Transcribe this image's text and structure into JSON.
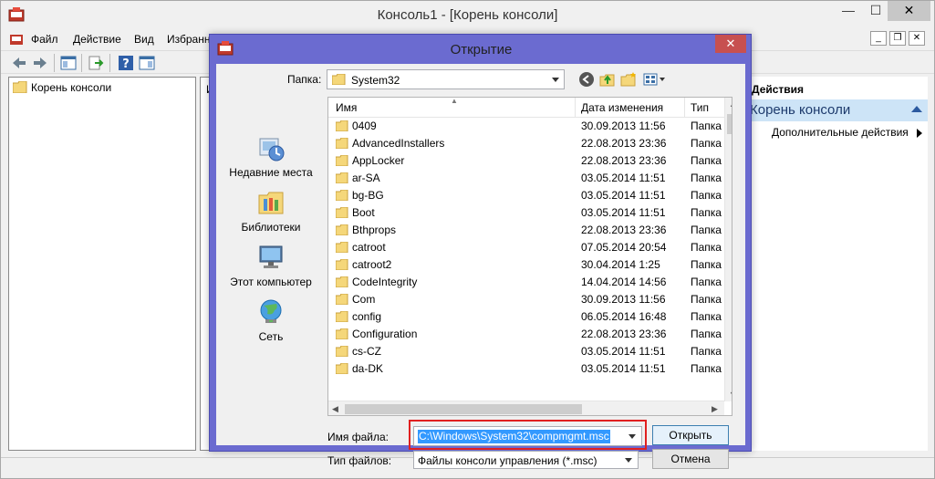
{
  "mmc": {
    "title": "Консоль1 - [Корень консоли]",
    "menu": [
      "Файл",
      "Действие",
      "Вид",
      "Избранное"
    ],
    "tree_root": "Корень консоли",
    "center_header": "И",
    "actions": {
      "title": "Действия",
      "selected": "Корень консоли",
      "more": "Дополнительные действия"
    }
  },
  "dialog": {
    "title": "Открытие",
    "close_glyph": "✕",
    "folder_label": "Папка:",
    "folder_value": "System32",
    "places": [
      {
        "label": "Недавние места",
        "icon": "recent-places-icon"
      },
      {
        "label": "Библиотеки",
        "icon": "libraries-icon"
      },
      {
        "label": "Этот компьютер",
        "icon": "this-pc-icon"
      },
      {
        "label": "Сеть",
        "icon": "network-icon"
      }
    ],
    "columns": {
      "name": "Имя",
      "date": "Дата изменения",
      "type": "Тип"
    },
    "files": [
      {
        "name": "0409",
        "date": "30.09.2013 11:56",
        "type": "Папка"
      },
      {
        "name": "AdvancedInstallers",
        "date": "22.08.2013 23:36",
        "type": "Папка"
      },
      {
        "name": "AppLocker",
        "date": "22.08.2013 23:36",
        "type": "Папка"
      },
      {
        "name": "ar-SA",
        "date": "03.05.2014 11:51",
        "type": "Папка"
      },
      {
        "name": "bg-BG",
        "date": "03.05.2014 11:51",
        "type": "Папка"
      },
      {
        "name": "Boot",
        "date": "03.05.2014 11:51",
        "type": "Папка"
      },
      {
        "name": "Bthprops",
        "date": "22.08.2013 23:36",
        "type": "Папка"
      },
      {
        "name": "catroot",
        "date": "07.05.2014 20:54",
        "type": "Папка"
      },
      {
        "name": "catroot2",
        "date": "30.04.2014 1:25",
        "type": "Папка"
      },
      {
        "name": "CodeIntegrity",
        "date": "14.04.2014 14:56",
        "type": "Папка"
      },
      {
        "name": "Com",
        "date": "30.09.2013 11:56",
        "type": "Папка"
      },
      {
        "name": "config",
        "date": "06.05.2014 16:48",
        "type": "Папка"
      },
      {
        "name": "Configuration",
        "date": "22.08.2013 23:36",
        "type": "Папка"
      },
      {
        "name": "cs-CZ",
        "date": "03.05.2014 11:51",
        "type": "Папка"
      },
      {
        "name": "da-DK",
        "date": "03.05.2014 11:51",
        "type": "Папка"
      }
    ],
    "filename_label": "Имя файла:",
    "filename_value": "C:\\Windows\\System32\\compmgmt.msc",
    "filetype_label": "Тип файлов:",
    "filetype_value": "Файлы консоли управления (*.msc)",
    "open_button": "Открыть",
    "cancel_button": "Отмена",
    "highlight_color": "#e02020"
  }
}
